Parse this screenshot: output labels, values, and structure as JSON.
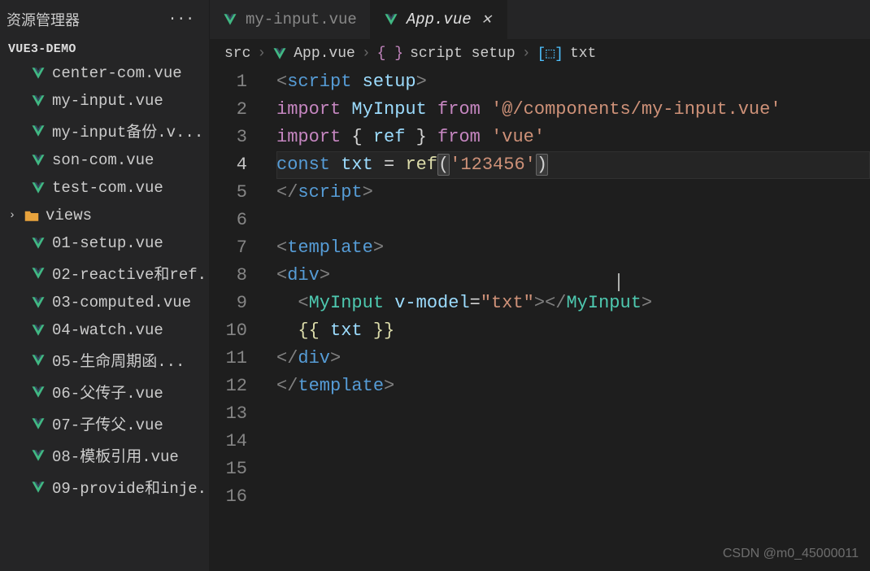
{
  "sidebar": {
    "title": "资源管理器",
    "project": "VUE3-DEMO",
    "more_label": "···",
    "items": [
      {
        "name": "center-com.vue",
        "icon": "vue"
      },
      {
        "name": "my-input.vue",
        "icon": "vue"
      },
      {
        "name": "my-input备份.v...",
        "icon": "vue"
      },
      {
        "name": "son-com.vue",
        "icon": "vue"
      },
      {
        "name": "test-com.vue",
        "icon": "vue"
      },
      {
        "name": "views",
        "icon": "folder",
        "folder": true
      },
      {
        "name": "01-setup.vue",
        "icon": "vue"
      },
      {
        "name": "02-reactive和ref....",
        "icon": "vue"
      },
      {
        "name": "03-computed.vue",
        "icon": "vue"
      },
      {
        "name": "04-watch.vue",
        "icon": "vue"
      },
      {
        "name": "05-生命周期函...",
        "icon": "vue"
      },
      {
        "name": "06-父传子.vue",
        "icon": "vue"
      },
      {
        "name": "07-子传父.vue",
        "icon": "vue"
      },
      {
        "name": "08-模板引用.vue",
        "icon": "vue"
      },
      {
        "name": "09-provide和inje...",
        "icon": "vue"
      }
    ]
  },
  "tabs": [
    {
      "label": "my-input.vue",
      "active": false
    },
    {
      "label": "App.vue",
      "active": true
    }
  ],
  "breadcrumb": {
    "p0": "src",
    "p1": "App.vue",
    "p2": "script setup",
    "p3": "txt"
  },
  "code": {
    "l1_tag": "script",
    "l1_attr": "setup",
    "l2_import": "import",
    "l2_sym": "MyInput",
    "l2_from": "from",
    "l2_str": "'@/components/my-input.vue'",
    "l3_import": "import",
    "l3_brace_l": "{",
    "l3_ref": "ref",
    "l3_brace_r": "}",
    "l3_from": "from",
    "l3_str": "'vue'",
    "l4_const": "const",
    "l4_var": "txt",
    "l4_eq": "=",
    "l4_fn": "ref",
    "l4_paren_l": "(",
    "l4_arg": "'123456'",
    "l4_paren_r": ")",
    "l5_tag": "script",
    "l7_tag": "template",
    "l8_tag": "div",
    "l9_tag": "MyInput",
    "l9_attr": "v-model",
    "l9_eq": "=",
    "l9_val": "\"txt\"",
    "l10_l": "{{",
    "l10_v": " txt ",
    "l10_r": "}}",
    "l11_tag": "div",
    "l12_tag": "template"
  },
  "line_count": 16,
  "active_line": 4,
  "watermark": "CSDN @m0_45000011"
}
